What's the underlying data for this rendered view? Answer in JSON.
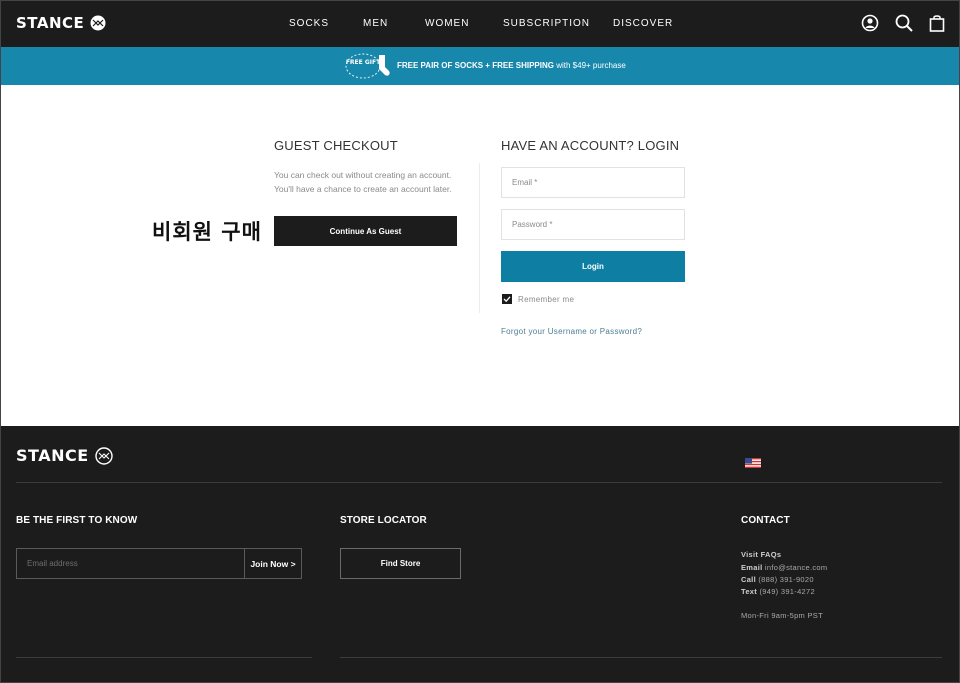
{
  "header": {
    "logo": "STANCE",
    "nav": [
      "SOCKS",
      "MEN",
      "WOMEN",
      "SUBSCRIPTION",
      "DISCOVER"
    ]
  },
  "promo": {
    "badge": "FREE GIFT",
    "bold": "FREE PAIR OF SOCKS + FREE SHIPPING",
    "rest": " with $49+ purchase"
  },
  "guest": {
    "title": "GUEST CHECKOUT",
    "line1": "You can check out without creating an account.",
    "line2": "You'll have a chance to create an account later.",
    "button": "Continue As Guest",
    "annotation": "비회원 구매"
  },
  "login": {
    "title": "HAVE AN ACCOUNT? LOGIN",
    "email_placeholder": "Email *",
    "password_placeholder": "Password *",
    "button": "Login",
    "remember": "Remember me",
    "forgot": "Forgot your Username or Password?"
  },
  "footer": {
    "logo": "STANCE",
    "newsletter_title": "BE THE FIRST TO KNOW",
    "email_placeholder": "Email address",
    "join_button": "Join Now >",
    "store_title": "STORE LOCATOR",
    "store_button": "Find Store",
    "contact_title": "CONTACT",
    "faqs": "Visit FAQs",
    "email_label": "Email",
    "email_value": " info@stance.com",
    "call_label": "Call",
    "call_value": " (888) 391-9020",
    "text_label": "Text",
    "text_value": " (949) 391-4272",
    "hours": "Mon-Fri 9am-5pm PST"
  },
  "colors": {
    "dark": "#1c1c1c",
    "promo_blue": "#1787ab",
    "login_blue": "#0e7fa3"
  }
}
